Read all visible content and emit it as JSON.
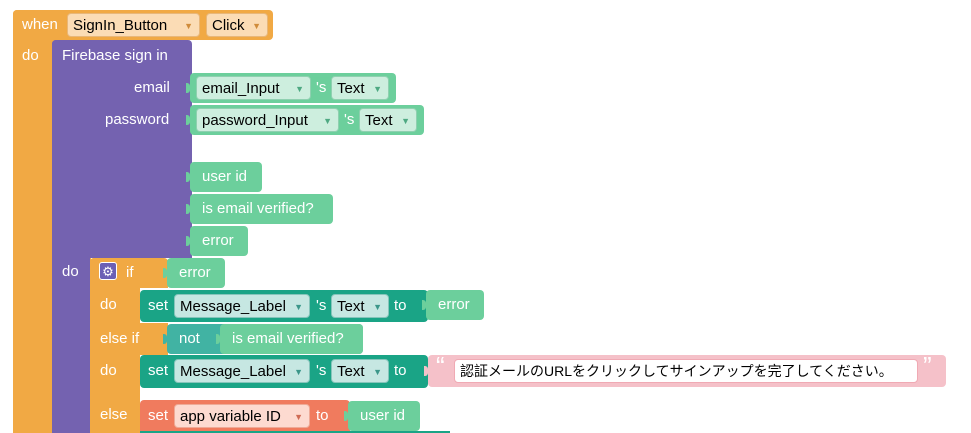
{
  "colors": {
    "event_orange": "#f1a944",
    "firebase_purple": "#7462b0",
    "if_orange": "#f1a944",
    "value_green": "#6ccf9c",
    "set_teal": "#1aa486",
    "not_teal": "#41b3a3",
    "text_pink": "#f5c1c9",
    "var_red": "#f07b5e"
  },
  "event": {
    "when_label": "when",
    "component": "SignIn_Button",
    "event_name": "Click",
    "do_label": "do"
  },
  "firebase": {
    "title": "Firebase sign in",
    "email_label": "email",
    "password_label": "password",
    "email_component": "email_Input",
    "password_component": "password_Input",
    "possessive": "'s",
    "property": "Text",
    "outputs": [
      "user id",
      "is email verified?",
      "error"
    ],
    "do_label": "do"
  },
  "ifblock": {
    "gear_icon": "gear-icon",
    "if_label": "if",
    "if_value": "error",
    "do1_label": "do",
    "set_label": "set",
    "target_component": "Message_Label",
    "possessive": "'s",
    "property": "Text",
    "to_label": "to",
    "set1_value": "error",
    "elseif_label": "else if",
    "not_label": "not",
    "not_value": "is email verified?",
    "do2_label": "do",
    "message_text": "認証メールのURLをクリックしてサインアップを完了してください。",
    "open_quote": "“",
    "close_quote": "”",
    "else_label": "else",
    "var_set_label": "set",
    "var_name": "app variable ID",
    "var_to_label": "to",
    "var_value": "user id"
  }
}
